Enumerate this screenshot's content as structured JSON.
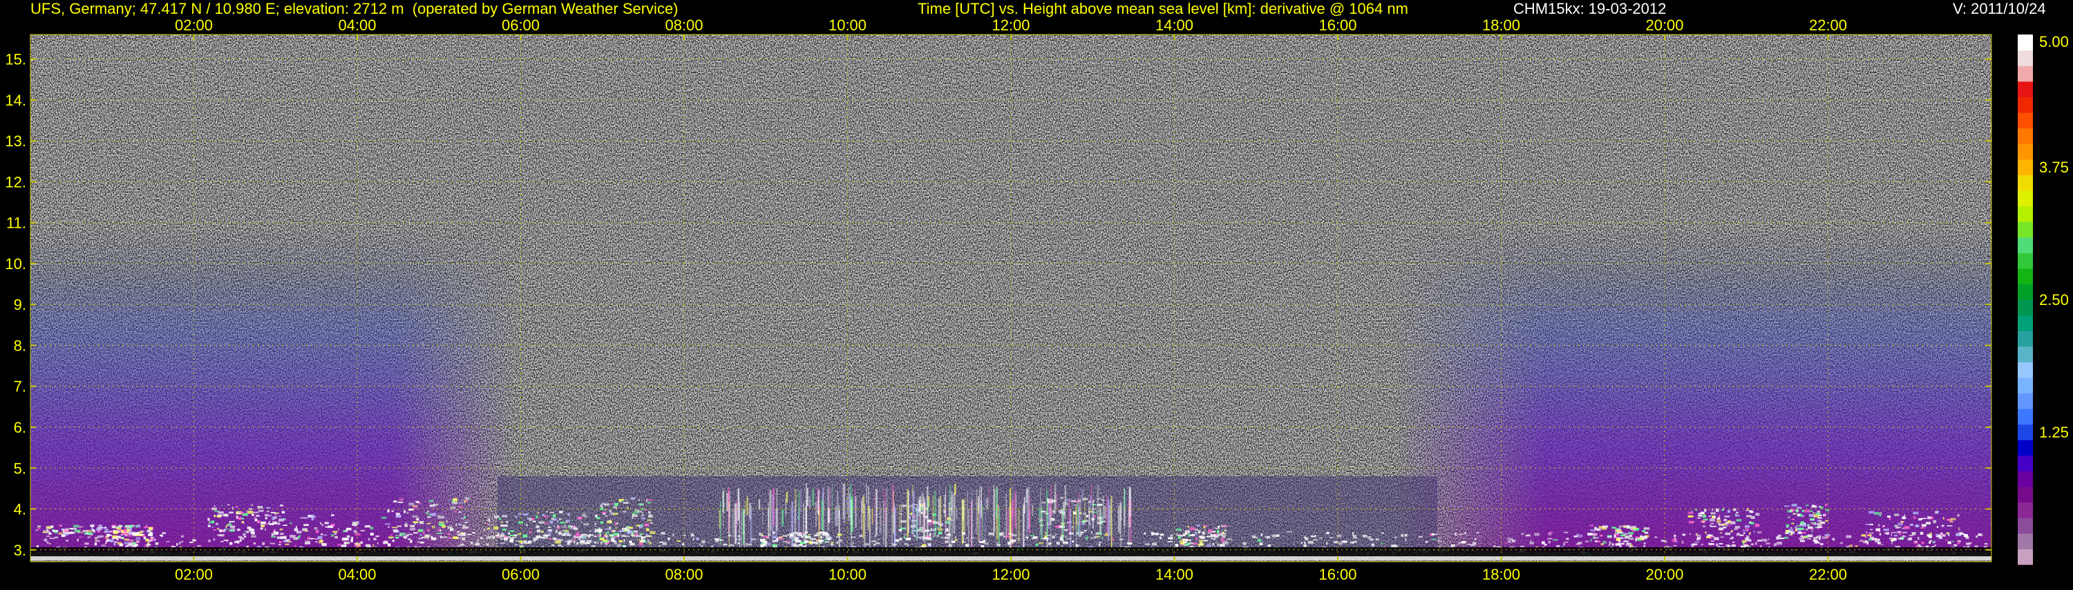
{
  "header": {
    "station": "UFS, Germany; 47.417 N / 10.980 E; elevation: 2712 m  (operated by German Weather Service)",
    "description": "Time [UTC] vs. Height above mean sea level [km]: derivative @ 1064 nm",
    "instrument_date": "CHM15kx: 19-03-2012",
    "version": "V: 2011/10/24"
  },
  "colors": {
    "background": "#000000",
    "text": "#ffff00",
    "grid": "#c8c800",
    "header_white": "#ffffff"
  },
  "chart_data": {
    "type": "heatmap",
    "title": "Time [UTC] vs. Height above mean sea level [km]: derivative @ 1064 nm",
    "xlabel": "Time [UTC]",
    "ylabel": "Height above mean sea level [km]",
    "x_ticks": [
      "02:00",
      "04:00",
      "06:00",
      "08:00",
      "10:00",
      "12:00",
      "14:00",
      "16:00",
      "18:00",
      "20:00",
      "22:00"
    ],
    "x_tick_hours": [
      2,
      4,
      6,
      8,
      10,
      12,
      14,
      16,
      18,
      20,
      22
    ],
    "xlim_hours": [
      0,
      24
    ],
    "y_ticks": [
      "3.",
      "4.",
      "5.",
      "6.",
      "7.",
      "8.",
      "9.",
      "10.",
      "11.",
      "12.",
      "13.",
      "14.",
      "15."
    ],
    "y_tick_values": [
      3,
      4,
      5,
      6,
      7,
      8,
      9,
      10,
      11,
      12,
      13,
      14,
      15
    ],
    "ylim_km": [
      2.71,
      15.6
    ],
    "grid": true,
    "colorbar": {
      "tick_labels": [
        "5.00",
        "3.75",
        "2.50",
        "1.25"
      ],
      "tick_values": [
        5.0,
        3.75,
        2.5,
        1.25
      ],
      "range": [
        0,
        5.0
      ],
      "colors": [
        "#c8a0c0",
        "#a078a8",
        "#8c4c9c",
        "#8c2896",
        "#780a8c",
        "#6a00a0",
        "#4600c8",
        "#0000c8",
        "#1e46e6",
        "#3c78ff",
        "#6496ff",
        "#78b4ff",
        "#96c8ff",
        "#5ab4c8",
        "#28a0a0",
        "#00a078",
        "#009650",
        "#00a028",
        "#14b414",
        "#32c83c",
        "#50dc78",
        "#78e628",
        "#b4f000",
        "#dcf000",
        "#f0dc00",
        "#ffb400",
        "#ff9600",
        "#ff7800",
        "#ff5000",
        "#f02800",
        "#e61414",
        "#f0aaaa",
        "#f0dcdc",
        "#ffffff"
      ]
    }
  }
}
